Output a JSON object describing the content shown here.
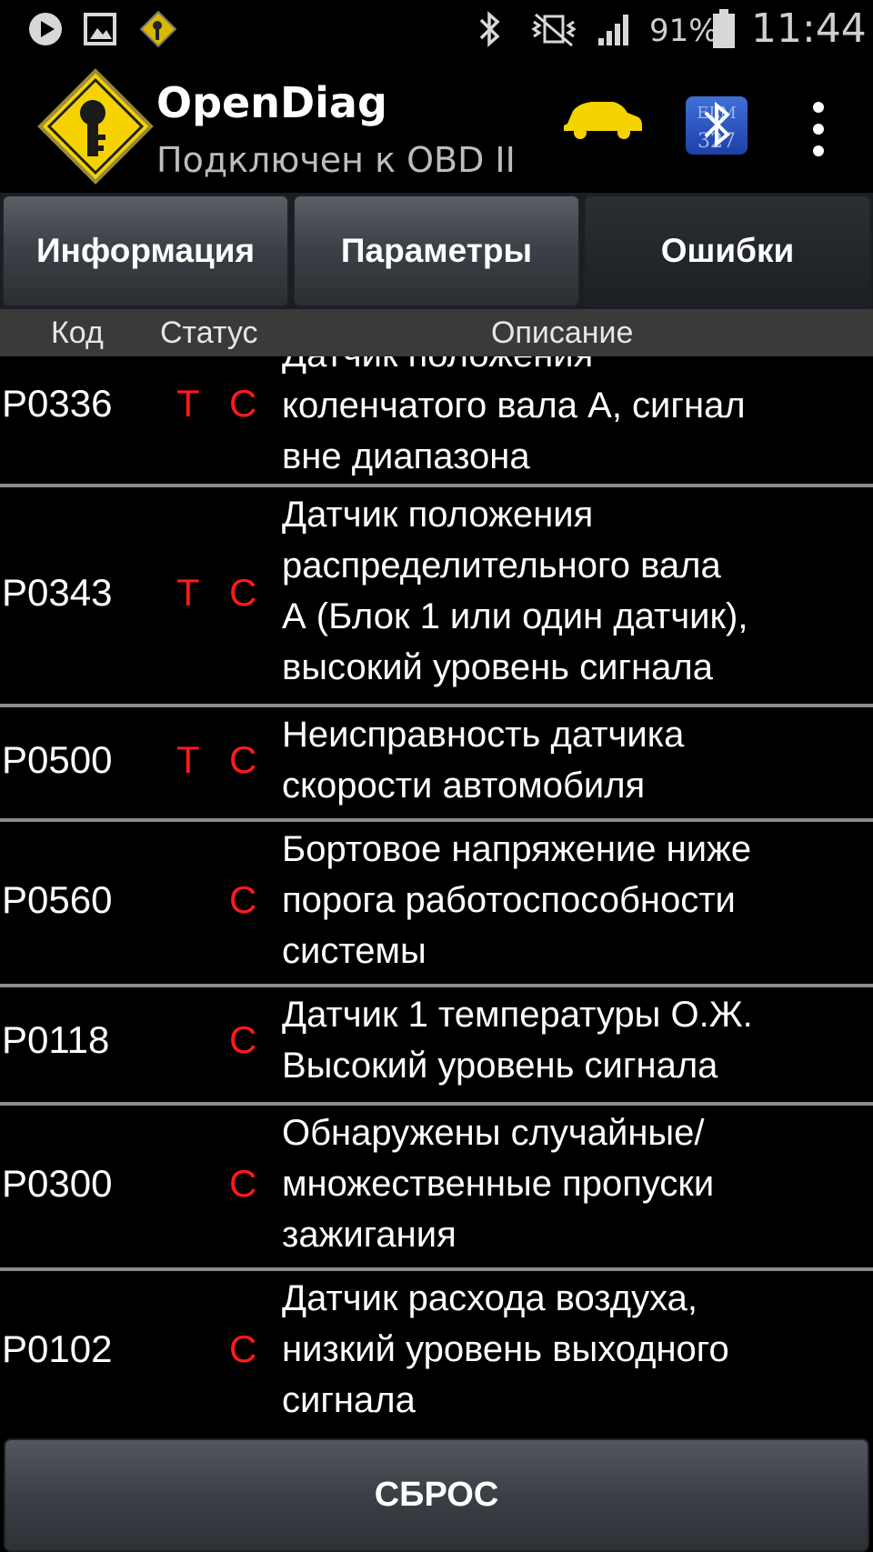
{
  "status_bar": {
    "battery": "91%",
    "time": "11:44",
    "icons": [
      "play-icon",
      "image-icon",
      "opendiag-notify-icon",
      "bluetooth-icon",
      "vibrate-icon",
      "signal-icon",
      "battery-icon"
    ]
  },
  "app_bar": {
    "title": "OpenDiag",
    "subtitle": "Подключен к OBD II",
    "bt_badge": "ELM\n327"
  },
  "tabs": [
    {
      "label": "Информация",
      "active": false
    },
    {
      "label": "Параметры",
      "active": false
    },
    {
      "label": "Ошибки",
      "active": true
    }
  ],
  "columns": {
    "code": "Код",
    "status": "Статус",
    "description": "Описание"
  },
  "errors": [
    {
      "code": "P0336",
      "t": "Т",
      "c": "С",
      "description": "Датчик положения\nколенчатого вала А, сигнал\nвне диапазона"
    },
    {
      "code": "P0343",
      "t": "Т",
      "c": "С",
      "description": "Датчик положения\nраспределительного вала\nА (Блок 1 или один датчик),\nвысокий уровень сигнала"
    },
    {
      "code": "P0500",
      "t": "Т",
      "c": "С",
      "description": "Неисправность датчика\nскорости автомобиля"
    },
    {
      "code": "P0560",
      "t": "",
      "c": "С",
      "description": "Бортовое напряжение ниже\nпорога работоспособности\nсистемы"
    },
    {
      "code": "P0118",
      "t": "",
      "c": "С",
      "description": "Датчик 1 температуры О.Ж.\nВысокий уровень сигнала"
    },
    {
      "code": "P0300",
      "t": "",
      "c": "С",
      "description": "Обнаружены случайные/\nмножественные пропуски\nзажигания"
    },
    {
      "code": "P0102",
      "t": "",
      "c": "С",
      "description": "Датчик расхода воздуха,\nнизкий уровень выходного\nсигнала"
    }
  ],
  "reset_label": "СБРОС",
  "colors": {
    "status_red": "#ff1a1a",
    "background": "#000000",
    "logo_yellow": "#f5d300"
  }
}
